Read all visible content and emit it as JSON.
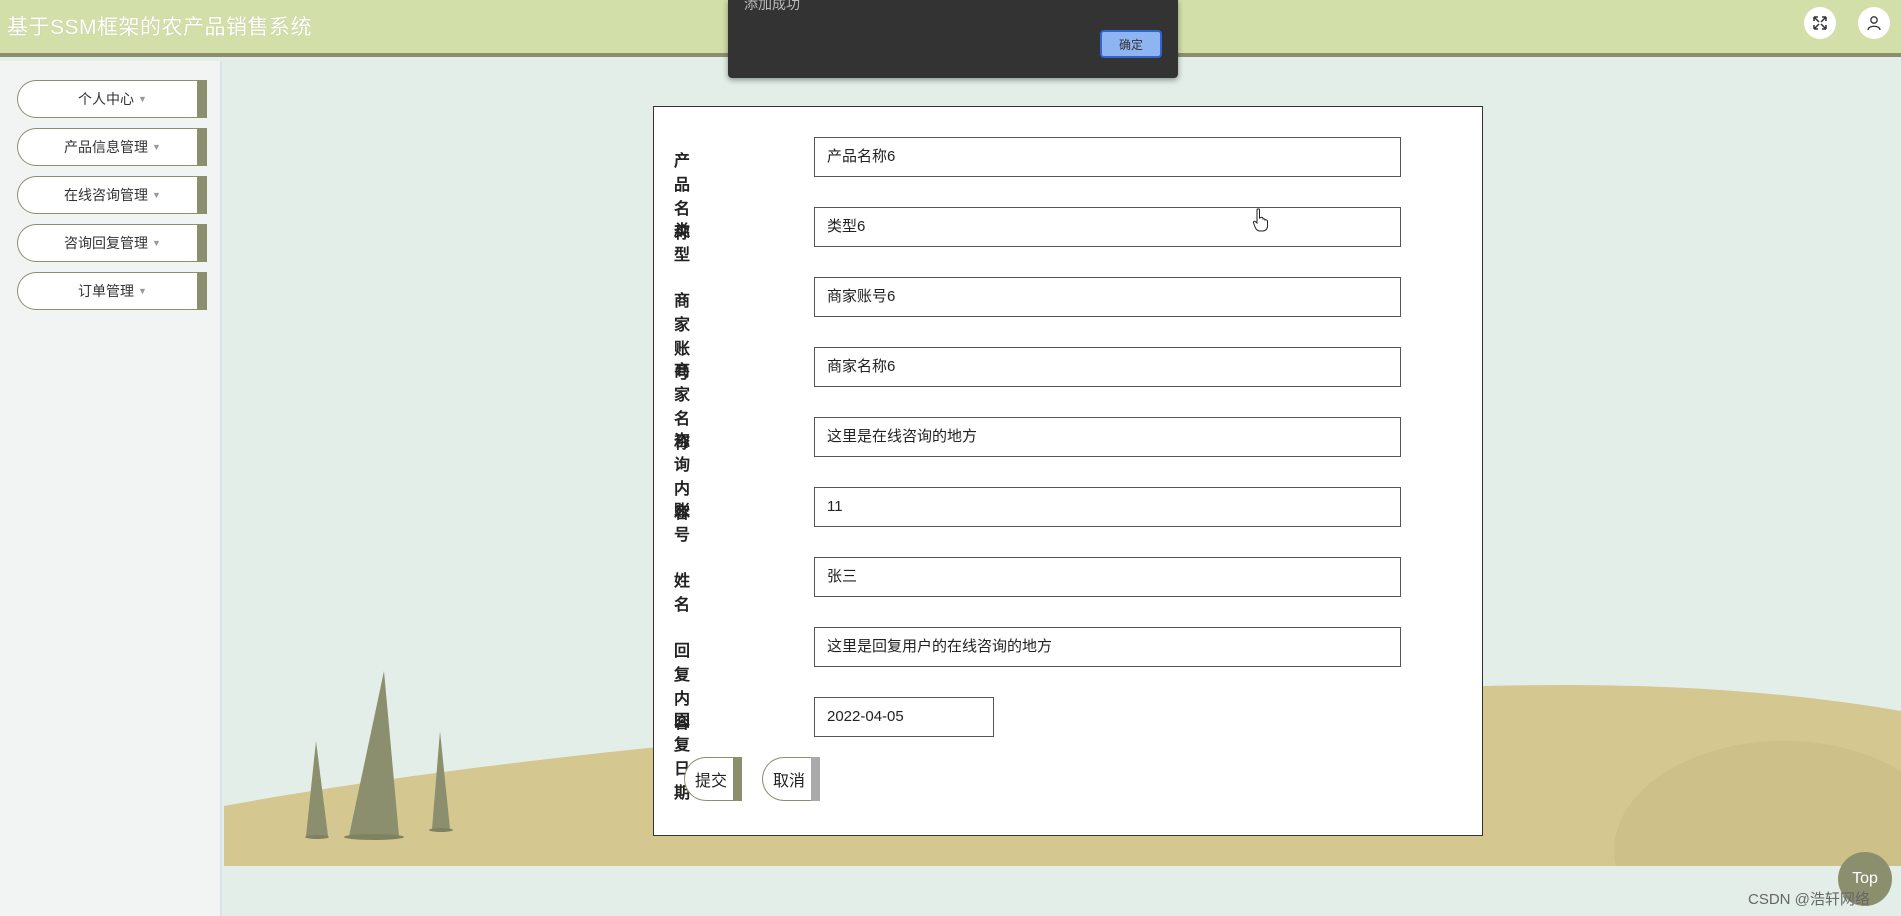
{
  "header": {
    "title": "基于SSM框架的农产品销售系统",
    "fullscreen_icon": "fullscreen-icon",
    "user_icon": "user-icon",
    "color": "#d2dfa9"
  },
  "sidebar": {
    "items": [
      {
        "label": "个人中心"
      },
      {
        "label": "产品信息管理"
      },
      {
        "label": "在线咨询管理"
      },
      {
        "label": "咨询回复管理"
      },
      {
        "label": "订单管理"
      }
    ]
  },
  "form": {
    "fields": [
      {
        "label": "产品名称",
        "value": "产品名称6"
      },
      {
        "label": "类型",
        "value": "类型6"
      },
      {
        "label": "商家账号",
        "value": "商家账号6"
      },
      {
        "label": "商家名称",
        "value": "商家名称6"
      },
      {
        "label": "咨询内容",
        "value": "这里是在线咨询的地方"
      },
      {
        "label": "账号",
        "value": "11"
      },
      {
        "label": "姓名",
        "value": "张三"
      },
      {
        "label": "回复内容",
        "value": "这里是回复用户的在线咨询的地方"
      },
      {
        "label": "回复日期",
        "value": "2022-04-05"
      }
    ],
    "submit_label": "提交",
    "cancel_label": "取消"
  },
  "alert": {
    "message": "添加成功",
    "ok_label": "确定"
  },
  "top_button": "Top",
  "watermark": "CSDN @浩轩网络",
  "colors": {
    "accent": "#8c8f6e",
    "background": "#e3eee8",
    "hill": "#d4c790"
  }
}
